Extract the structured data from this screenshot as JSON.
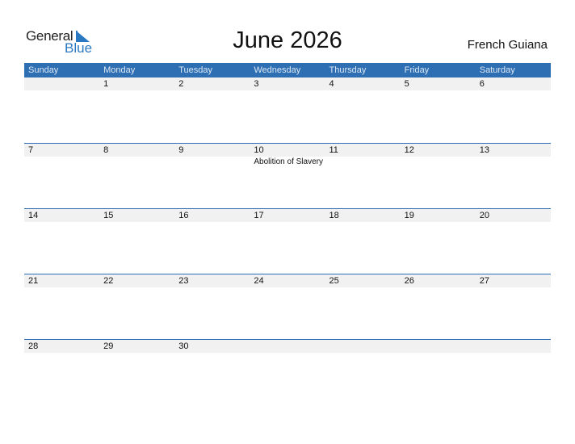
{
  "logo": {
    "general": "General",
    "blue": "Blue"
  },
  "title": "June 2026",
  "country": "French Guiana",
  "weekdays": [
    "Sunday",
    "Monday",
    "Tuesday",
    "Wednesday",
    "Thursday",
    "Friday",
    "Saturday"
  ],
  "weeks": [
    {
      "days": [
        "",
        "1",
        "2",
        "3",
        "4",
        "5",
        "6"
      ],
      "events": [
        "",
        "",
        "",
        "",
        "",
        "",
        ""
      ]
    },
    {
      "days": [
        "7",
        "8",
        "9",
        "10",
        "11",
        "12",
        "13"
      ],
      "events": [
        "",
        "",
        "",
        "Abolition of Slavery",
        "",
        "",
        ""
      ]
    },
    {
      "days": [
        "14",
        "15",
        "16",
        "17",
        "18",
        "19",
        "20"
      ],
      "events": [
        "",
        "",
        "",
        "",
        "",
        "",
        ""
      ]
    },
    {
      "days": [
        "21",
        "22",
        "23",
        "24",
        "25",
        "26",
        "27"
      ],
      "events": [
        "",
        "",
        "",
        "",
        "",
        "",
        ""
      ]
    },
    {
      "days": [
        "28",
        "29",
        "30",
        "",
        "",
        "",
        ""
      ],
      "events": [
        "",
        "",
        "",
        "",
        "",
        "",
        ""
      ]
    }
  ],
  "colors": {
    "header": "#2e6fb3",
    "brand_blue": "#2a78c2",
    "strip": "#f1f1f1"
  }
}
